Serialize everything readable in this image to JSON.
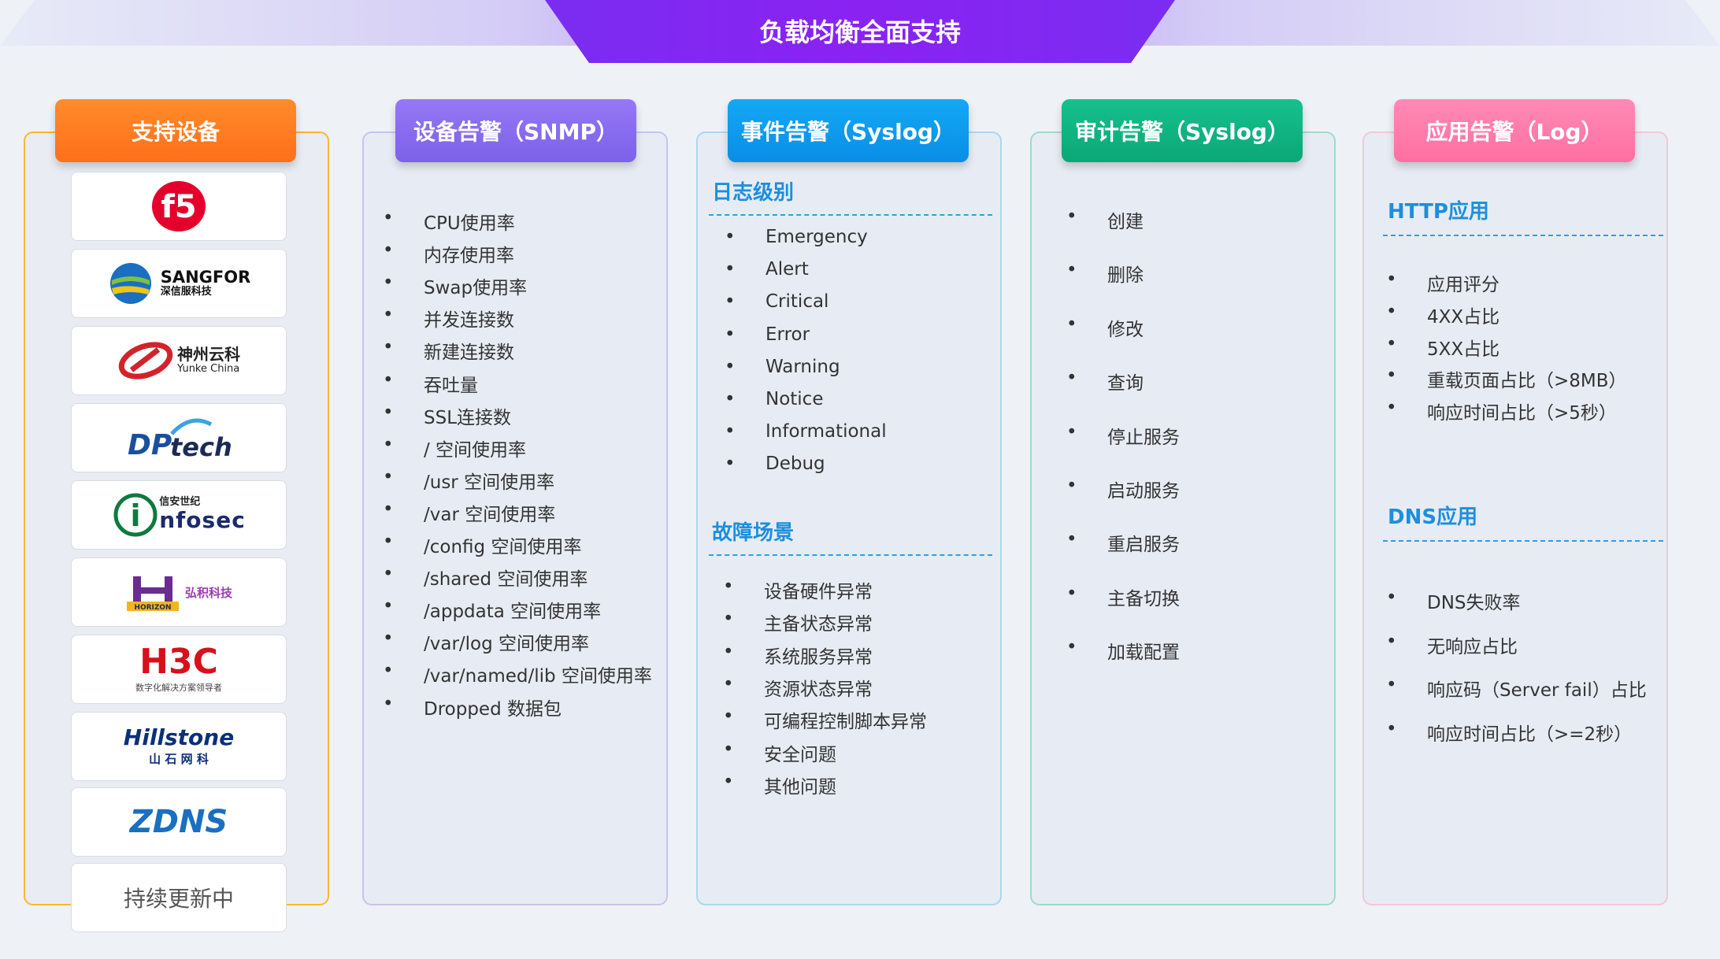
{
  "title": "负载均衡全面支持",
  "columns": {
    "devices": {
      "tab": "支持设备",
      "logos": [
        {
          "name": "f5"
        },
        {
          "name": "SANGFOR",
          "sub": "深信服科技"
        },
        {
          "name": "神州云科",
          "sub": "Yunke China"
        },
        {
          "name": "DP",
          "tech": "tech"
        },
        {
          "name": "信安世纪",
          "sub": "nfosec",
          "mark": "i"
        },
        {
          "name": "HORIZON",
          "sub": "弘积科技"
        },
        {
          "name": "H3C",
          "sub": "数字化解决方案领导者"
        },
        {
          "name": "Hillstone",
          "sub": "山 石 网 科"
        },
        {
          "name": "ZDNS"
        }
      ],
      "more": "持续更新中"
    },
    "snmp": {
      "tab": "设备告警（SNMP）",
      "items": [
        "CPU使用率",
        "内存使用率",
        "Swap使用率",
        "并发连接数",
        "新建连接数",
        "吞吐量",
        "SSL连接数",
        "/ 空间使用率",
        "/usr 空间使用率",
        "/var 空间使用率",
        "/config 空间使用率",
        "/shared 空间使用率",
        "/appdata 空间使用率",
        "/var/log 空间使用率",
        "/var/named/lib 空间使用率",
        "Dropped 数据包"
      ]
    },
    "syslog_event": {
      "tab": "事件告警（Syslog）",
      "section1": "日志级别",
      "levels": [
        "Emergency",
        "Alert",
        "Critical",
        "Error",
        "Warning",
        "Notice",
        "Informational",
        "Debug"
      ],
      "section2": "故障场景",
      "faults": [
        "设备硬件异常",
        "主备状态异常",
        "系统服务异常",
        "资源状态异常",
        "可编程控制脚本异常",
        "安全问题",
        "其他问题"
      ]
    },
    "syslog_audit": {
      "tab": "审计告警（Syslog）",
      "items": [
        "创建",
        "删除",
        "修改",
        "查询",
        "停止服务",
        "启动服务",
        "重启服务",
        "主备切换",
        "加载配置"
      ]
    },
    "log": {
      "tab": "应用告警（Log）",
      "section1": "HTTP应用",
      "http": [
        "应用评分",
        "4XX占比",
        "5XX占比",
        "重载页面占比（>8MB）",
        "响应时间占比（>5秒）"
      ],
      "section2": "DNS应用",
      "dns": [
        "DNS失败率",
        "无响应占比",
        "响应码（Server fail）占比",
        "响应时间占比（>=2秒）"
      ]
    }
  },
  "colors": {
    "banner": "#8a22f2",
    "devices": "#ff7a21",
    "snmp": "#8b6cf0",
    "syslog_event": "#0b9af0",
    "syslog_audit": "#12b383",
    "log": "#ff78a8"
  }
}
